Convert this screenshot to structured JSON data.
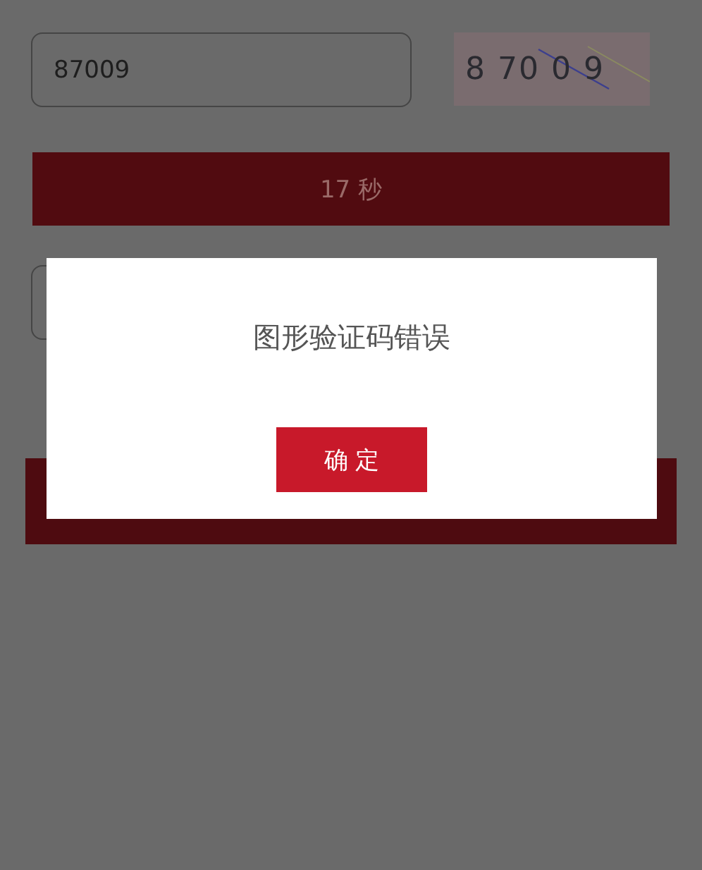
{
  "code_field": {
    "value": "87009"
  },
  "captcha": {
    "text": "8 70 0 9"
  },
  "countdown_button": {
    "label": "17 秒",
    "disabled": true
  },
  "dialog": {
    "message": "图形验证码错误",
    "button": "确 定"
  }
}
